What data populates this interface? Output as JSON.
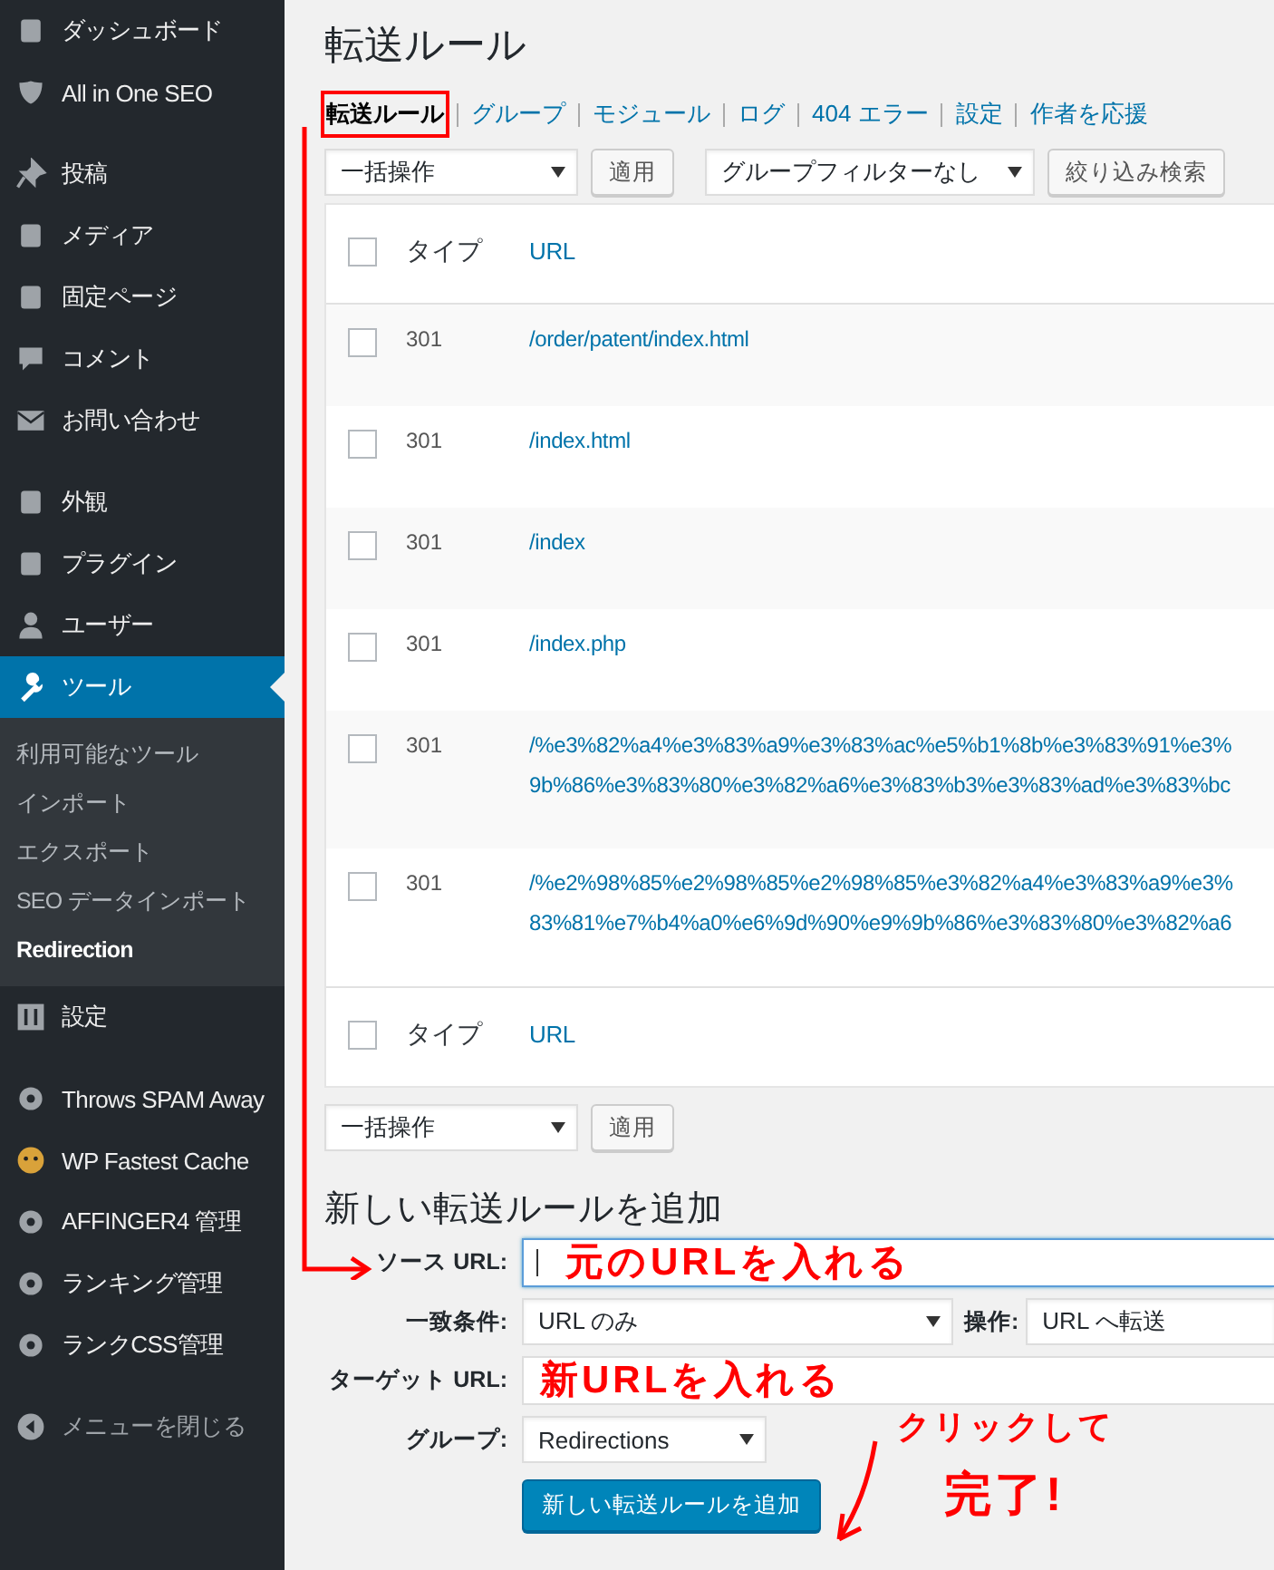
{
  "sidebar": {
    "groups": [
      [
        {
          "label": "ダッシュボード",
          "selected": false
        },
        {
          "label": "All in One SEO",
          "selected": false
        }
      ],
      [
        {
          "label": "投稿",
          "selected": false
        },
        {
          "label": "メディア",
          "selected": false
        },
        {
          "label": "固定ページ",
          "selected": false
        },
        {
          "label": "コメント",
          "selected": false
        },
        {
          "label": "お問い合わせ",
          "selected": false
        }
      ],
      [
        {
          "label": "外観",
          "selected": false
        },
        {
          "label": "プラグイン",
          "selected": false
        },
        {
          "label": "ユーザー",
          "selected": false
        },
        {
          "label": "ツール",
          "selected": true,
          "children": [
            {
              "label": "利用可能なツール",
              "selected": false
            },
            {
              "label": "インポート",
              "selected": false
            },
            {
              "label": "エクスポート",
              "selected": false
            },
            {
              "label": "SEO データインポート",
              "selected": false
            },
            {
              "label": "Redirection",
              "selected": true
            }
          ]
        },
        {
          "label": "設定",
          "selected": false
        }
      ],
      [
        {
          "label": "Throws SPAM Away",
          "selected": false
        },
        {
          "label": "WP Fastest Cache",
          "selected": false
        },
        {
          "label": "AFFINGER4 管理",
          "selected": false
        },
        {
          "label": "ランキング管理",
          "selected": false
        },
        {
          "label": "ランクCSS管理",
          "selected": false
        }
      ]
    ],
    "collapse": "メニューを閉じる"
  },
  "title": "転送ルール",
  "tabs": [
    {
      "label": "転送ルール",
      "selected": true,
      "boxed": true
    },
    {
      "label": "グループ",
      "selected": false,
      "boxed": false
    },
    {
      "label": "モジュール",
      "selected": false,
      "boxed": false
    },
    {
      "label": "ログ",
      "selected": false,
      "boxed": false
    },
    {
      "label": "404 エラー",
      "selected": false,
      "boxed": false
    },
    {
      "label": "設定",
      "selected": false,
      "boxed": false
    },
    {
      "label": "作者を応援",
      "selected": false,
      "boxed": false
    }
  ],
  "top_actions": {
    "bulk": "一括操作",
    "apply": "適用",
    "group_filter": "グループフィルターなし",
    "filter": "絞り込み検索"
  },
  "table": {
    "columns": [
      "タイプ",
      "URL"
    ],
    "header_checked": false,
    "footer_checked": false,
    "rows": [
      {
        "type": "301",
        "url": [
          "/order/patent/index.html"
        ],
        "checked": false
      },
      {
        "type": "301",
        "url": [
          "/index.html"
        ],
        "checked": false
      },
      {
        "type": "301",
        "url": [
          "/index"
        ],
        "checked": false
      },
      {
        "type": "301",
        "url": [
          "/index.php"
        ],
        "checked": false
      },
      {
        "type": "301",
        "url": [
          "/%e3%82%a4%e3%83%a9%e3%83%ac%e5%b1%8b%e3%83%91%e3%",
          "9b%86%e3%83%80%e3%82%a6%e3%83%b3%e3%83%ad%e3%83%bc"
        ],
        "checked": false
      },
      {
        "type": "301",
        "url": [
          "/%e2%98%85%e2%98%85%e2%98%85%e3%82%a4%e3%83%a9%e3%",
          "83%81%e7%b4%a0%e6%9d%90%e9%9b%86%e3%83%80%e3%82%a6"
        ],
        "checked": false
      }
    ],
    "footer_columns": [
      "タイプ",
      "URL"
    ]
  },
  "bottom_actions": {
    "bulk": "一括操作",
    "apply": "適用"
  },
  "add_form": {
    "heading": "新しい転送ルールを追加",
    "source_label": "ソース URL:",
    "match_label": "一致条件:",
    "match_value": "URL のみ",
    "action_label": "操作:",
    "action_value": "URL へ転送",
    "target_label": "ターゲット URL:",
    "group_label": "グループ:",
    "group_value": "Redirections",
    "submit": "新しい転送ルールを追加"
  },
  "annotations": {
    "source_note": "元のURLを入れる",
    "target_note": "新URLを入れる",
    "click_note": "クリックして",
    "done_note": "完了!"
  }
}
